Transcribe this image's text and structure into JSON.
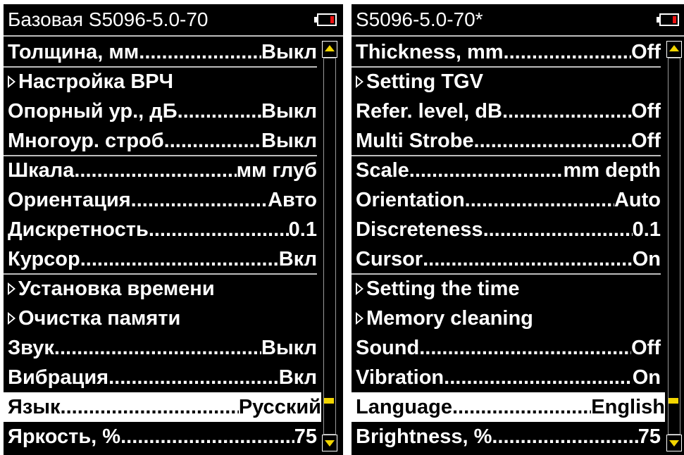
{
  "left": {
    "title": "Базовая S5096-5.0-70",
    "items": [
      {
        "label": "Толщина, мм",
        "value": "Выкл"
      },
      {
        "label": "Настройка ВРЧ",
        "submenu": true
      },
      {
        "label": "Опорный ур., дБ",
        "value": "Выкл"
      },
      {
        "label": "Многоур. строб",
        "value": "Выкл"
      },
      {
        "label": "Шкала",
        "value": "мм глуб"
      },
      {
        "label": "Ориентация",
        "value": "Авто"
      },
      {
        "label": "Дискретность",
        "value": "0.1"
      },
      {
        "label": "Курсор",
        "value": "Вкл"
      },
      {
        "label": "Установка времени",
        "submenu": true
      },
      {
        "label": "Очистка памяти",
        "submenu": true
      },
      {
        "label": "Звук",
        "value": "Выкл"
      },
      {
        "label": "Вибрация",
        "value": "Вкл"
      },
      {
        "label": "Язык",
        "value": "Русский",
        "selected": true
      },
      {
        "label": "Яркость, %",
        "value": "75"
      }
    ]
  },
  "right": {
    "title": "S5096-5.0-70*",
    "items": [
      {
        "label": "Thickness, mm",
        "value": "Off"
      },
      {
        "label": "Setting TGV",
        "submenu": true
      },
      {
        "label": "Refer. level, dB",
        "value": "Off"
      },
      {
        "label": "Multi Strobe",
        "value": "Off"
      },
      {
        "label": "Scale",
        "value": "mm depth"
      },
      {
        "label": "Orientation",
        "value": "Auto"
      },
      {
        "label": "Discreteness",
        "value": "0.1"
      },
      {
        "label": "Cursor",
        "value": "On"
      },
      {
        "label": "Setting the time",
        "submenu": true
      },
      {
        "label": "Memory cleaning",
        "submenu": true
      },
      {
        "label": "Sound",
        "value": "Off"
      },
      {
        "label": "Vibration",
        "value": "On"
      },
      {
        "label": "Language",
        "value": "English",
        "selected": true
      },
      {
        "label": "Brightness, %",
        "value": "75"
      }
    ]
  },
  "scroll_position": 0.92,
  "colors": {
    "background": "#000000",
    "text": "#ffffff",
    "selection_bg": "#ffffff",
    "selection_text": "#000000",
    "scrollbar_accent": "#f2d500",
    "battery_level": "#e11111"
  },
  "icons": [
    "battery-icon",
    "submenu-arrow-icon",
    "scroll-up-icon",
    "scroll-down-icon"
  ]
}
